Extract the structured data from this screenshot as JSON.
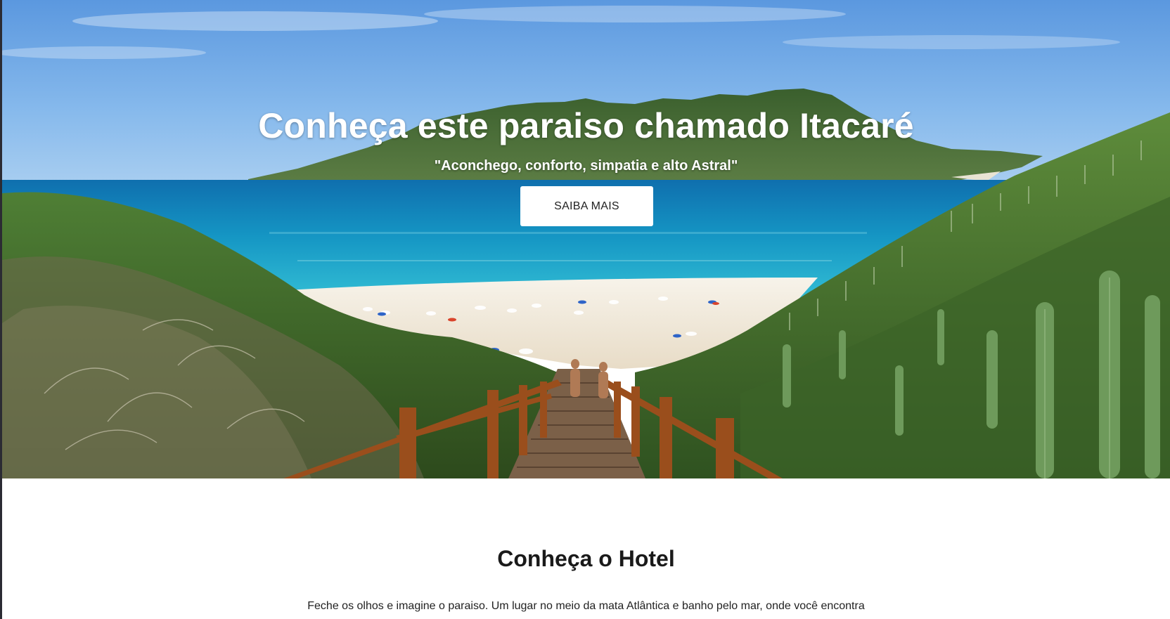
{
  "hero": {
    "title": "Conheça este paraiso chamado Itacaré",
    "subtitle": "\"Aconchego, conforto, simpatia e alto Astral\"",
    "button_label": "SAIBA MAIS"
  },
  "about": {
    "title": "Conheça o Hotel",
    "text": "Feche os olhos e imagine o paraiso. Um lugar no meio da mata Atlântica e banho pelo mar, onde você encontra a paz."
  },
  "colors": {
    "sky": "#6fa8e6",
    "sea": "#1aa2c8",
    "sand": "#f3eee3",
    "vegetation": "#3f6b2a",
    "boardwalk": "#8a4a1e",
    "button_bg": "#ffffff"
  }
}
